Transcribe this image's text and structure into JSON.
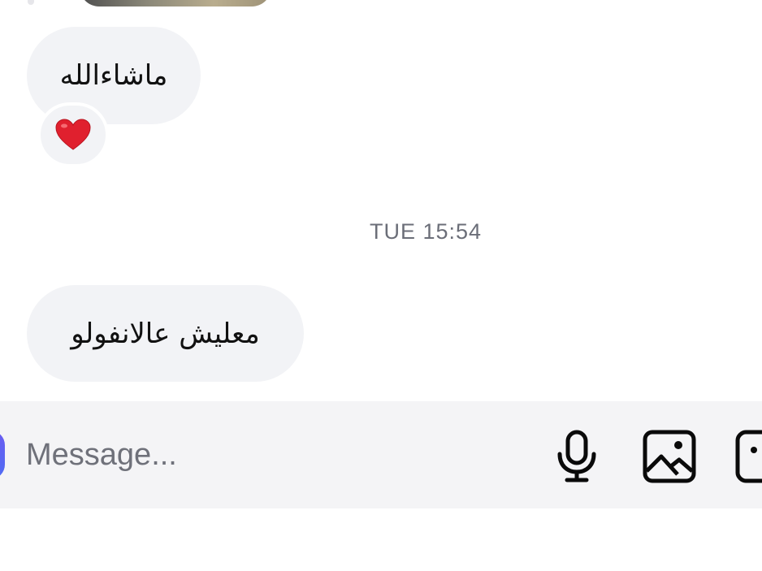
{
  "conversation": {
    "messages": [
      {
        "text": "ماشاءالله",
        "reaction": "❤️"
      },
      {
        "text": "معليش عالانفولو"
      }
    ],
    "timestamp": "TUE 15:54"
  },
  "composer": {
    "placeholder": "Message...",
    "icons": {
      "mic": "microphone-icon",
      "gallery": "image-icon",
      "sticker": "sticker-icon"
    }
  },
  "colors": {
    "bubble_bg": "#f2f3f6",
    "composer_bg": "#f4f4f6",
    "timestamp_text": "#6b6e78",
    "heart": "#e0202e"
  }
}
